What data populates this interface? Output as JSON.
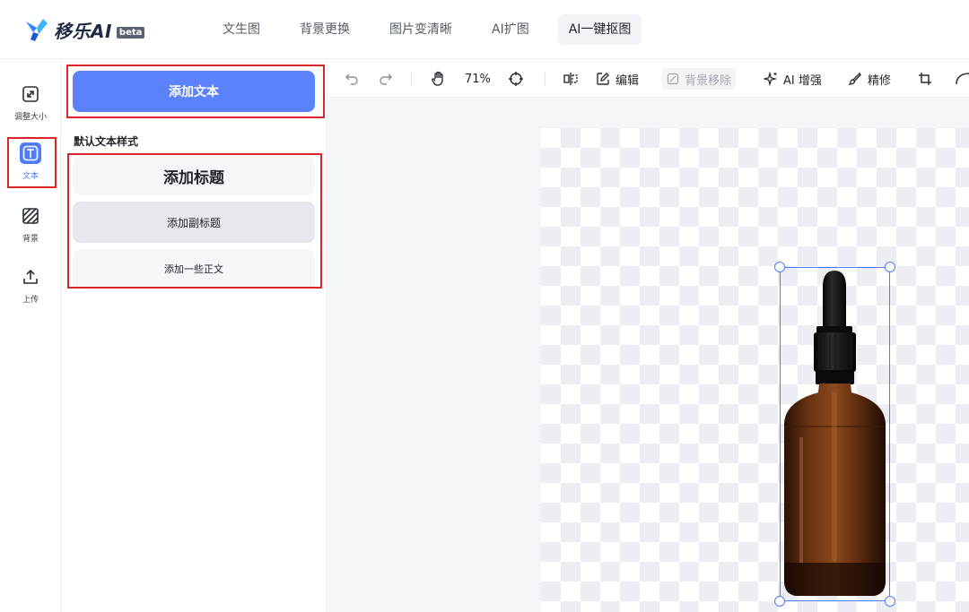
{
  "brand": {
    "name": "移乐AI",
    "badge": "beta"
  },
  "nav": [
    {
      "label": "文生图"
    },
    {
      "label": "背景更换"
    },
    {
      "label": "图片变清晰"
    },
    {
      "label": "AI扩图"
    },
    {
      "label": "AI一键抠图",
      "active": true
    }
  ],
  "rail": [
    {
      "label": "调整大小",
      "icon": "resize-icon"
    },
    {
      "label": "文本",
      "icon": "text-icon",
      "active": true
    },
    {
      "label": "背景",
      "icon": "background-icon"
    },
    {
      "label": "上传",
      "icon": "upload-icon"
    }
  ],
  "panel": {
    "add_text_label": "添加文本",
    "section_title": "默认文本样式",
    "styles": [
      "添加标题",
      "添加副标题",
      "添加一些正文"
    ]
  },
  "toolbar": {
    "zoom": "71%",
    "edit": "编辑",
    "remove_bg": "背景移除",
    "ai_enhance": "AI 增强",
    "refine": "精修"
  },
  "colors": {
    "accent": "#4f7cff",
    "primary_button": "#5b82fa",
    "highlight": "#d9262b"
  }
}
